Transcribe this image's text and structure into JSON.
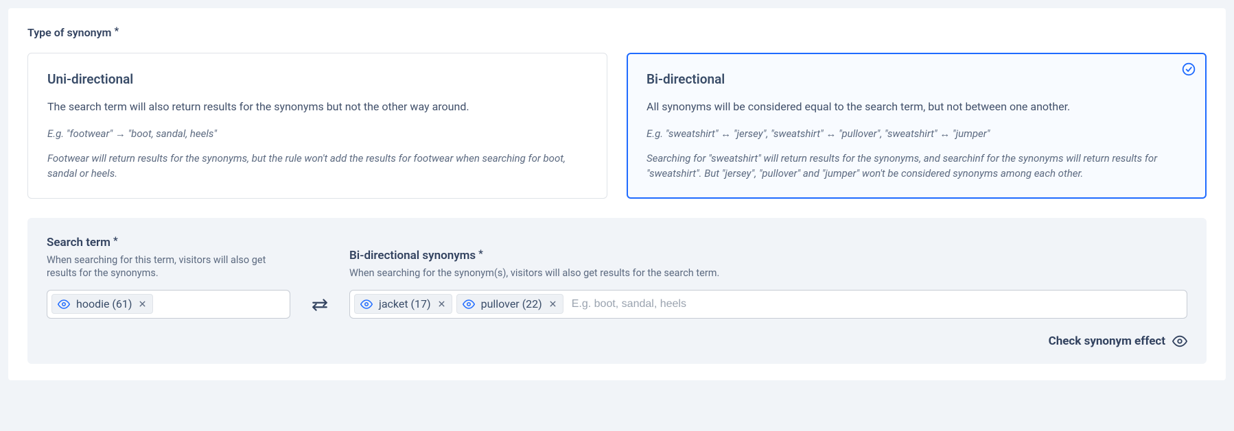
{
  "section": {
    "title": "Type of synonym"
  },
  "cards": {
    "uni": {
      "title": "Uni-directional",
      "desc": "The search term will also return results for the synonyms but not the other way around.",
      "example": "E.g. \"footwear\" → \"boot, sandal, heels\"",
      "footnote": "Footwear will return results for the synonyms, but the rule won't add the results for footwear when searching for boot, sandal or heels."
    },
    "bi": {
      "title": "Bi-directional",
      "desc": "All synonyms will be considered equal to the search term, but not between one another.",
      "example": "E.g. \"sweatshirt\" ↔ \"jersey\", \"sweatshirt\" ↔ \"pullover\", \"sweatshirt\" ↔ \"jumper\"",
      "footnote": "Searching for \"sweatshirt\" will return results for the synonyms, and searchinf for the synonyms will return results for \"sweatshirt\". But \"jersey\", \"pullover\" and \"jumper\" won't be considered synonyms among each other."
    }
  },
  "search_term": {
    "label": "Search term",
    "help": "When searching for this term, visitors will also get results for the synonyms.",
    "tags": [
      {
        "label": "hoodie (61)"
      }
    ]
  },
  "synonyms": {
    "label": "Bi-directional synonyms",
    "help": "When searching for the synonym(s), visitors will also get results for the search term.",
    "tags": [
      {
        "label": "jacket (17)"
      },
      {
        "label": "pullover (22)"
      }
    ],
    "placeholder": "E.g. boot, sandal, heels"
  },
  "footer": {
    "check_label": "Check synonym effect"
  }
}
